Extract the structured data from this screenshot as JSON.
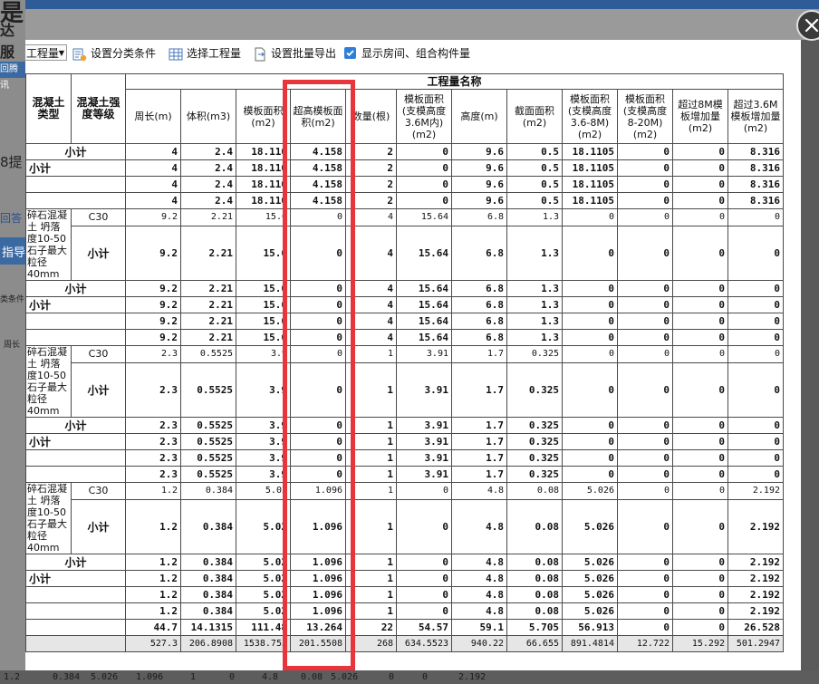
{
  "background": {
    "text_a": "是",
    "text_b": "达服",
    "text_c": "8提",
    "text_d": "回答",
    "text_e": "指导",
    "text_f": "类条件",
    "text_g": "周长",
    "tag": "回腾讯",
    "bottom_strip": [
      "1.2",
      "0.384",
      "5.026",
      "1.096",
      "1",
      "0",
      "4.8",
      "0.08",
      "5.026",
      "0",
      "0",
      "2.192"
    ]
  },
  "toolbar": {
    "quantity_select": "工程量",
    "set_category": "设置分类条件",
    "select_quantity": "选择工程量",
    "batch_export": "设置批量导出",
    "show_rooms": "显示房间、组合构件量"
  },
  "table": {
    "group_header": "工程量名称",
    "headers": {
      "concrete_type": "混凝土类型",
      "strength": "混凝土强度等级",
      "perimeter": "周长(m)",
      "volume": "体积(m3)",
      "formwork_area": "模板面积(m2)",
      "high_formwork": "超高模板面积(m2)",
      "count": "数量(根)",
      "formwork_lt36": "模板面积(支模高度3.6M内)(m2)",
      "height": "高度(m)",
      "section_area": "截面面积(m2)",
      "formwork_36_8": "模板面积(支模高度3.6-8M)(m2)",
      "formwork_8_20": "模板面积(支模高度8-20M)(m2)",
      "over8m_add": "超过8M模板增加量(m2)",
      "over36_add": "超过3.6M模板增加量(m2)"
    },
    "labels": {
      "subtotal": "小计",
      "grade": "C30",
      "desc": "碎石混凝土 坍落度10-50 石子最大粒径40mm"
    },
    "groups": [
      {
        "detail": null,
        "sub": null,
        "rows": [
          [
            "4",
            "2.4",
            "18.110",
            "4.158",
            "2",
            "0",
            "9.6",
            "0.5",
            "18.1105",
            "0",
            "0",
            "8.316"
          ],
          [
            "4",
            "2.4",
            "18.110",
            "4.158",
            "2",
            "0",
            "9.6",
            "0.5",
            "18.1105",
            "0",
            "0",
            "8.316"
          ],
          [
            "4",
            "2.4",
            "18.110",
            "4.158",
            "2",
            "0",
            "9.6",
            "0.5",
            "18.1105",
            "0",
            "0",
            "8.316"
          ],
          [
            "4",
            "2.4",
            "18.110",
            "4.158",
            "2",
            "0",
            "9.6",
            "0.5",
            "18.1105",
            "0",
            "0",
            "8.316"
          ]
        ]
      },
      {
        "detail": [
          "9.2",
          "2.21",
          "15.6",
          "0",
          "4",
          "15.64",
          "6.8",
          "1.3",
          "0",
          "0",
          "0",
          "0"
        ],
        "sub": [
          "9.2",
          "2.21",
          "15.6",
          "0",
          "4",
          "15.64",
          "6.8",
          "1.3",
          "0",
          "0",
          "0",
          "0"
        ],
        "rows": [
          [
            "9.2",
            "2.21",
            "15.6",
            "0",
            "4",
            "15.64",
            "6.8",
            "1.3",
            "0",
            "0",
            "0",
            "0"
          ],
          [
            "9.2",
            "2.21",
            "15.6",
            "0",
            "4",
            "15.64",
            "6.8",
            "1.3",
            "0",
            "0",
            "0",
            "0"
          ],
          [
            "9.2",
            "2.21",
            "15.6",
            "0",
            "4",
            "15.64",
            "6.8",
            "1.3",
            "0",
            "0",
            "0",
            "0"
          ],
          [
            "9.2",
            "2.21",
            "15.6",
            "0",
            "4",
            "15.64",
            "6.8",
            "1.3",
            "0",
            "0",
            "0",
            "0"
          ]
        ]
      },
      {
        "detail": [
          "2.3",
          "0.5525",
          "3.9",
          "0",
          "1",
          "3.91",
          "1.7",
          "0.325",
          "0",
          "0",
          "0",
          "0"
        ],
        "sub": [
          "2.3",
          "0.5525",
          "3.9",
          "0",
          "1",
          "3.91",
          "1.7",
          "0.325",
          "0",
          "0",
          "0",
          "0"
        ],
        "rows": [
          [
            "2.3",
            "0.5525",
            "3.9",
            "0",
            "1",
            "3.91",
            "1.7",
            "0.325",
            "0",
            "0",
            "0",
            "0"
          ],
          [
            "2.3",
            "0.5525",
            "3.9",
            "0",
            "1",
            "3.91",
            "1.7",
            "0.325",
            "0",
            "0",
            "0",
            "0"
          ],
          [
            "2.3",
            "0.5525",
            "3.9",
            "0",
            "1",
            "3.91",
            "1.7",
            "0.325",
            "0",
            "0",
            "0",
            "0"
          ],
          [
            "2.3",
            "0.5525",
            "3.9",
            "0",
            "1",
            "3.91",
            "1.7",
            "0.325",
            "0",
            "0",
            "0",
            "0"
          ]
        ]
      },
      {
        "detail": [
          "1.2",
          "0.384",
          "5.02",
          "1.096",
          "1",
          "0",
          "4.8",
          "0.08",
          "5.026",
          "0",
          "0",
          "2.192"
        ],
        "sub": [
          "1.2",
          "0.384",
          "5.02",
          "1.096",
          "1",
          "0",
          "4.8",
          "0.08",
          "5.026",
          "0",
          "0",
          "2.192"
        ],
        "rows": [
          [
            "1.2",
            "0.384",
            "5.02",
            "1.096",
            "1",
            "0",
            "4.8",
            "0.08",
            "5.026",
            "0",
            "0",
            "2.192"
          ],
          [
            "1.2",
            "0.384",
            "5.02",
            "1.096",
            "1",
            "0",
            "4.8",
            "0.08",
            "5.026",
            "0",
            "0",
            "2.192"
          ],
          [
            "1.2",
            "0.384",
            "5.02",
            "1.096",
            "1",
            "0",
            "4.8",
            "0.08",
            "5.026",
            "0",
            "0",
            "2.192"
          ],
          [
            "1.2",
            "0.384",
            "5.02",
            "1.096",
            "1",
            "0",
            "4.8",
            "0.08",
            "5.026",
            "0",
            "0",
            "2.192"
          ]
        ]
      }
    ],
    "total": [
      "44.7",
      "14.1315",
      "111.48",
      "13.264",
      "22",
      "54.57",
      "59.1",
      "5.705",
      "56.913",
      "0",
      "0",
      "26.528"
    ],
    "grand_total": [
      "527.3",
      "206.8908",
      "1538.755",
      "201.5508",
      "268",
      "634.5523",
      "940.22",
      "66.655",
      "891.4814",
      "12.722",
      "15.292",
      "501.2947"
    ]
  },
  "highlight_color": "#e8353b"
}
